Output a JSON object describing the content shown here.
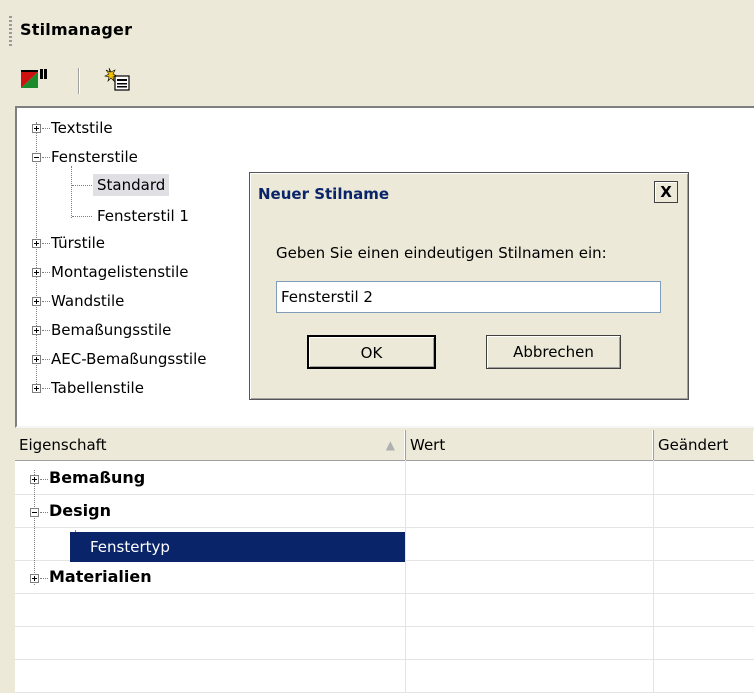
{
  "panel": {
    "title": "Stilmanager"
  },
  "toolbar": {
    "icons": [
      "filter-icon",
      "new-style-icon"
    ]
  },
  "tree": {
    "items": [
      {
        "label": "Textstile",
        "expanded": false
      },
      {
        "label": "Fensterstile",
        "expanded": true,
        "children": [
          "Standard",
          "Fensterstil 1"
        ]
      },
      {
        "label": "Türstile",
        "expanded": false
      },
      {
        "label": "Montagelistenstile",
        "expanded": false
      },
      {
        "label": "Wandstile",
        "expanded": false
      },
      {
        "label": "Bemaßungsstile",
        "expanded": false
      },
      {
        "label": "AEC-Bemaßungsstile",
        "expanded": false
      },
      {
        "label": "Tabellenstile",
        "expanded": false
      }
    ]
  },
  "dialog": {
    "title": "Neuer Stilname",
    "close_label": "X",
    "prompt": "Geben Sie einen eindeutigen Stilnamen ein:",
    "input_value": "Fensterstil 2",
    "ok_label": "OK",
    "cancel_label": "Abbrechen"
  },
  "grid": {
    "columns": [
      "Eigenschaft",
      "Wert",
      "Geändert"
    ],
    "sort_arrow": "▲",
    "rows": [
      {
        "label": "Bemaßung",
        "expanded": false
      },
      {
        "label": "Design",
        "expanded": true,
        "child": "Fenstertyp"
      },
      {
        "label": "Materialien",
        "expanded": false
      }
    ]
  },
  "colors": {
    "selection": "#0a246a",
    "panel": "#ece9d8"
  }
}
